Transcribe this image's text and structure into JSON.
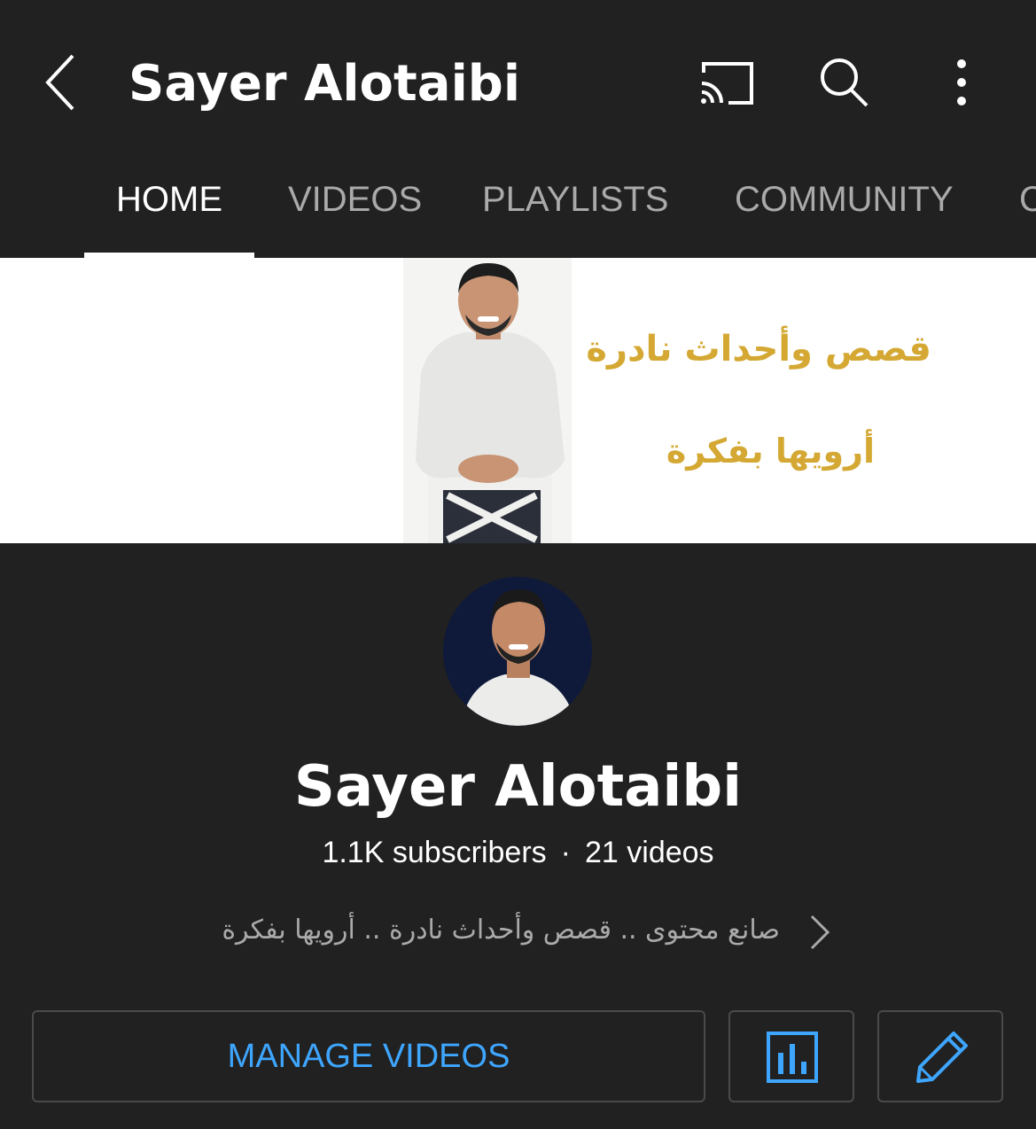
{
  "header": {
    "title": "Sayer Alotaibi",
    "icons": [
      "back-arrow-icon",
      "cast-icon",
      "search-icon",
      "more-vert-icon"
    ]
  },
  "tabs": [
    {
      "label": "HOME",
      "active": true
    },
    {
      "label": "VIDEOS",
      "active": false
    },
    {
      "label": "PLAYLISTS",
      "active": false
    },
    {
      "label": "COMMUNITY",
      "active": false
    },
    {
      "label": "C",
      "active": false
    }
  ],
  "banner": {
    "line1": "قصص وأحداث نادرة",
    "line2": "أرويها بفكرة",
    "text_color": "#d4a833"
  },
  "channel": {
    "name": "Sayer Alotaibi",
    "subscribers": "1.1K subscribers",
    "separator": "·",
    "videos": "21 videos",
    "description": "صانع محتوى .. قصص وأحداث نادرة .. أرويها بفكرة"
  },
  "actions": {
    "manage_label": "MANAGE VIDEOS",
    "analytics_icon": "bar-chart-icon",
    "edit_icon": "pencil-icon"
  },
  "colors": {
    "background": "#212121",
    "accent": "#3ea6ff",
    "inactive_tab": "#aaaaaa"
  }
}
